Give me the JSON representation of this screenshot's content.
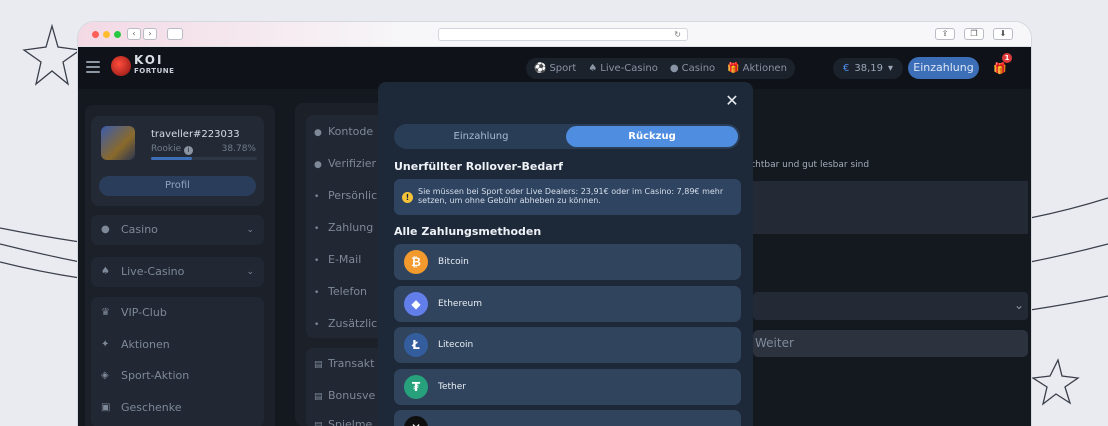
{
  "browser": {
    "traffic_colors": [
      "#ff5f57",
      "#febc2e",
      "#28c840"
    ],
    "back": "‹",
    "forward": "›",
    "reload": "↻"
  },
  "header": {
    "logo_top": "KOI",
    "logo_bottom": "FORTUNE",
    "nav": [
      {
        "icon": "⚽",
        "label": "Sport"
      },
      {
        "icon": "♠",
        "label": "Live-Casino"
      },
      {
        "icon": "●",
        "label": "Casino"
      },
      {
        "icon": "🎁",
        "label": "Aktionen"
      }
    ],
    "balance_symbol": "€",
    "balance_value": "38,19",
    "balance_caret": "▾",
    "deposit_label": "Einzahlung",
    "gift_badge": "1"
  },
  "profile": {
    "username": "traveller#223033",
    "rank": "Rookie",
    "rank_info": "i",
    "progress_label": "38.78%",
    "progress": 0.3878,
    "button": "Profil"
  },
  "sidebar": {
    "casino": "Casino",
    "live_casino": "Live-Casino",
    "items": [
      "VIP-Club",
      "Aktionen",
      "Sport-Aktion",
      "Geschenke"
    ]
  },
  "account_menu": {
    "items": [
      "Kontode",
      "Verifizier",
      "Persönlic",
      "Zahlung",
      "E-Mail",
      "Telefon",
      "Zusätzlic"
    ],
    "items2": [
      "Transakt",
      "Bonusve",
      "Spielme"
    ]
  },
  "content": {
    "hint": "sichtbar und gut lesbar sind",
    "continue": "Weiter"
  },
  "modal": {
    "close": "✕",
    "tab_deposit": "Einzahlung",
    "tab_withdraw": "Rückzug",
    "rollover_title": "Unerfüllter Rollover-Bedarf",
    "rollover_text": "Sie müssen bei Sport oder Live Dealers: 23,91€ oder im Casino: 7,89€ mehr setzen, um ohne Gebühr abheben zu können.",
    "methods_title": "Alle Zahlungsmethoden",
    "methods": [
      {
        "name": "Bitcoin",
        "glyph": "₿",
        "color": "#f29a2e"
      },
      {
        "name": "Ethereum",
        "glyph": "◆",
        "color": "#627eea"
      },
      {
        "name": "Litecoin",
        "glyph": "Ł",
        "color": "#345d9d"
      },
      {
        "name": "Tether",
        "glyph": "₮",
        "color": "#26a17b"
      },
      {
        "name": "",
        "glyph": "✕",
        "color": "#0f0f0f"
      }
    ]
  }
}
